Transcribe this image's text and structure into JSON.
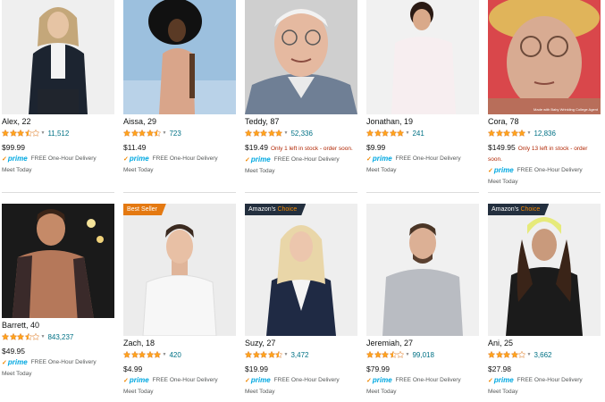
{
  "colors": {
    "star": "#ffa41c",
    "link": "#007185",
    "stock": "#b12704",
    "prime": "#00a8e1"
  },
  "products": [
    {
      "name": "Alex, 22",
      "stars": 3.5,
      "reviews": "11,512",
      "price": "$99.99",
      "stock": "",
      "stock2": "",
      "prime": "prime",
      "delivery": "FREE One-Hour Delivery",
      "meet": "Meet Today",
      "badge": "",
      "badge_hl": "",
      "photo_caption": ""
    },
    {
      "name": "Aissa, 29",
      "stars": 4.5,
      "reviews": "723",
      "price": "$11.49",
      "stock": "",
      "stock2": "",
      "prime": "prime",
      "delivery": "FREE One-Hour Delivery",
      "meet": "Meet Today",
      "badge": "",
      "badge_hl": "",
      "photo_caption": ""
    },
    {
      "name": "Teddy, 87",
      "stars": 5,
      "reviews": "52,336",
      "price": "$19.49",
      "stock": "Only 1 left in stock - order soon.",
      "stock2": "",
      "prime": "prime",
      "delivery": "FREE One-Hour Delivery",
      "meet": "Meet Today",
      "badge": "",
      "badge_hl": "",
      "photo_caption": ""
    },
    {
      "name": "Jonathan, 19",
      "stars": 5,
      "reviews": "241",
      "price": "$9.99",
      "stock": "",
      "stock2": "",
      "prime": "prime",
      "delivery": "FREE One-Hour Delivery",
      "meet": "Meet Today",
      "badge": "",
      "badge_hl": "",
      "photo_caption": ""
    },
    {
      "name": "Cora, 78",
      "stars": 5,
      "reviews": "12,836",
      "price": "$149.95",
      "stock": "Only 13 left in stock - order",
      "stock2": "soon.",
      "prime": "prime",
      "delivery": "FREE One-Hour Delivery",
      "meet": "Meet Today",
      "badge": "",
      "badge_hl": "",
      "photo_caption": "Made with Baby Wrinkling College Agent"
    },
    {
      "name": "Barrett, 40",
      "stars": 3.5,
      "reviews": "843,237",
      "price": "$49.95",
      "stock": "",
      "stock2": "",
      "prime": "prime",
      "delivery": "FREE One-Hour Delivery",
      "meet": "Meet Today",
      "badge": "",
      "badge_hl": "",
      "photo_caption": ""
    },
    {
      "name": "Zach, 18",
      "stars": 5,
      "reviews": "420",
      "price": "$4.99",
      "stock": "",
      "stock2": "",
      "prime": "prime",
      "delivery": "FREE One-Hour Delivery",
      "meet": "Meet Today",
      "badge": "Best Seller",
      "badge_hl": "",
      "photo_caption": ""
    },
    {
      "name": "Suzy, 27",
      "stars": 4.5,
      "reviews": "3,472",
      "price": "$19.99",
      "stock": "",
      "stock2": "",
      "prime": "prime",
      "delivery": "FREE One-Hour Delivery",
      "meet": "Meet Today",
      "badge": "Amazon's ",
      "badge_hl": "Choice",
      "photo_caption": ""
    },
    {
      "name": "Jeremiah, 27",
      "stars": 3.5,
      "reviews": "99,018",
      "price": "$79.99",
      "stock": "",
      "stock2": "",
      "prime": "prime",
      "delivery": "FREE One-Hour Delivery",
      "meet": "Meet Today",
      "badge": "",
      "badge_hl": "",
      "photo_caption": ""
    },
    {
      "name": "Ani, 25",
      "stars": 4,
      "reviews": "3,662",
      "price": "$27.98",
      "stock": "",
      "stock2": "",
      "prime": "prime",
      "delivery": "FREE One-Hour Delivery",
      "meet": "Meet Today",
      "badge": "Amazon's ",
      "badge_hl": "Choice",
      "photo_caption": ""
    }
  ]
}
